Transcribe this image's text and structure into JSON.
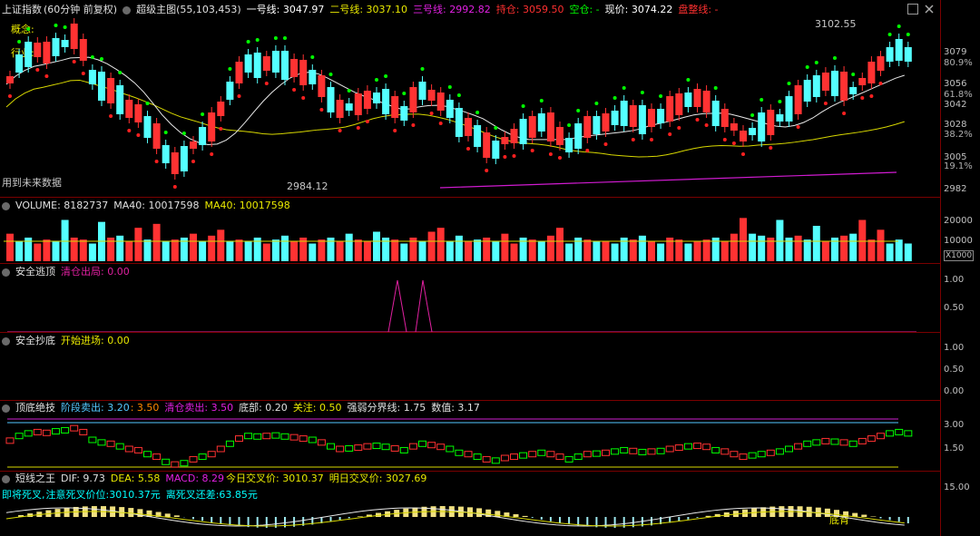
{
  "main": {
    "index_name": "上证指数",
    "period": "(60分钟 前复权)",
    "indicator": "超级主图(55,103,453)",
    "line1": "一号线: 3047.97",
    "line2": "二号线: 3037.10",
    "line3": "三号线: 2992.82",
    "hold": "持仓: 3059.50",
    "empty": "空仓: -",
    "price": "现价: 3074.22",
    "consolidate": "盘整线: -",
    "concept_label": "概念:",
    "industry_label": "行业:",
    "future_label": "用到未来数据",
    "high_label": "3102.55",
    "low_label": "2984.12",
    "axis": [
      "3079",
      "80.9%",
      "3056",
      "61.8%",
      "3042",
      "3028",
      "38.2%",
      "3005",
      "19.1%",
      "2982"
    ],
    "colors": {
      "up": "#ff3232",
      "down": "#54ffff",
      "white_line": "#e8e8e8",
      "yellow_line": "#d7d700",
      "magenta_line": "#d01bd0",
      "green_dot": "#00ff00",
      "red_dot": "#ff2020"
    }
  },
  "volume": {
    "title": "VOLUME: 8182737",
    "ma1": "MA40: 10017598",
    "ma2": "MA40: 10017598",
    "axis": [
      "20000",
      "10000"
    ],
    "unit": "X1000",
    "bars": [
      14,
      10,
      12,
      9,
      11,
      10,
      21,
      12,
      11,
      9,
      20,
      12,
      13,
      10,
      17,
      11,
      19,
      10,
      11,
      12,
      14,
      10,
      13,
      16,
      10,
      11,
      10,
      12,
      9,
      11,
      13,
      10,
      12,
      9,
      11,
      12,
      10,
      14,
      11,
      10,
      15,
      12,
      11,
      9,
      12,
      10,
      15,
      17,
      10,
      13,
      10,
      11,
      12,
      10,
      14,
      9,
      12,
      11,
      10,
      13,
      17,
      9,
      12,
      11,
      10,
      10,
      9,
      12,
      11,
      13,
      10,
      9,
      12,
      11,
      9,
      10,
      11,
      12,
      10,
      14,
      22,
      14,
      13,
      12,
      21,
      12,
      13,
      11,
      18,
      10,
      12,
      13,
      14,
      21,
      11,
      16,
      9,
      11,
      9
    ],
    "up": [
      1,
      0,
      0,
      1,
      1,
      0,
      0,
      1,
      1,
      0,
      0,
      1,
      0,
      1,
      1,
      0,
      1,
      0,
      1,
      0,
      1,
      0,
      1,
      1,
      0,
      1,
      0,
      0,
      1,
      0,
      0,
      1,
      1,
      0,
      1,
      0,
      1,
      0,
      1,
      1,
      0,
      0,
      1,
      0,
      1,
      0,
      1,
      1,
      0,
      0,
      1,
      0,
      1,
      0,
      1,
      1,
      0,
      1,
      0,
      1,
      1,
      0,
      0,
      1,
      0,
      1,
      0,
      0,
      1,
      0,
      1,
      0,
      1,
      1,
      0,
      1,
      1,
      0,
      1,
      1,
      1,
      0,
      0,
      1,
      0,
      0,
      1,
      0,
      0,
      1,
      0,
      1,
      0,
      1,
      1,
      1,
      0,
      0,
      0
    ]
  },
  "escape": {
    "title": "安全逃顶",
    "label": "清仓出局: 0.00",
    "axis": [
      "1.00",
      "0.50"
    ]
  },
  "bottom": {
    "title": "安全抄底",
    "label": "开始进场: 0.00",
    "axis": [
      "1.00",
      "0.50",
      "0.00"
    ]
  },
  "topbottom": {
    "title": "顶底绝技",
    "stage_sell": "阶段卖出: 3.20",
    "stage_sell2": ": 3.50",
    "clear_sell": "清仓卖出: 3.50",
    "bottom": "底部: 0.20",
    "focus": "关注: 0.50",
    "strong_weak": "强弱分界线: 1.75",
    "value": "数值: 3.17",
    "axis": [
      "3.00",
      "1.50"
    ]
  },
  "macd": {
    "title": "短线之王",
    "dif": "DIF: 9.73",
    "dea": "DEA: 5.58",
    "macd": "MACD: 8.29",
    "today_cross": "今日交叉价: 3010.37",
    "tomorrow_cross": "明日交叉价: 3027.69",
    "death_cross": "即将死叉,",
    "death_price": "注意死叉价位:3010.37元",
    "distance": "离死叉还差:63.85元",
    "axis": [
      "15.00"
    ],
    "buy_label": "底背"
  },
  "window_icons": [
    "restore-icon",
    "close-icon"
  ]
}
